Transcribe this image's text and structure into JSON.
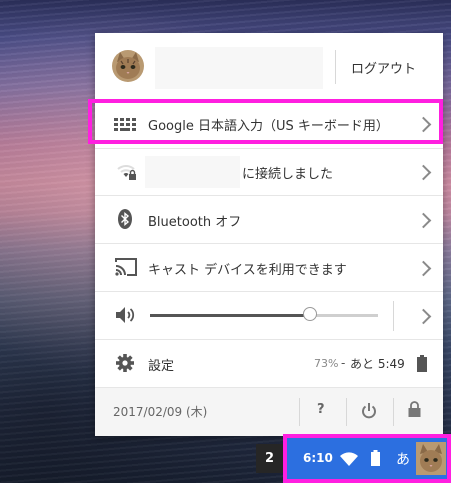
{
  "user": {
    "logout_label": "ログアウト"
  },
  "rows": {
    "ime_label": "Google 日本語入力（US キーボード用）",
    "network_suffix": "に接続しました",
    "bluetooth_label": "Bluetooth オフ",
    "cast_label": "キャスト デバイスを利用できます",
    "volume_level_percent": 70,
    "settings_label": "設定",
    "battery_percent": "73%",
    "battery_dash": "-",
    "battery_remaining": "あと 5:49"
  },
  "footer": {
    "date": "2017/02/09 (木)",
    "help_label": "?"
  },
  "shelf": {
    "window_count": "2",
    "time": "6:10",
    "ime_indicator": "あ"
  },
  "colors": {
    "highlight": "#ff1fe0",
    "tray_bg": "#2c6fe0"
  },
  "icons": {
    "avatar": "cat-avatar-icon",
    "keyboard": "keyboard-icon",
    "wifi_lock": "wifi-lock-icon",
    "bluetooth": "bluetooth-icon",
    "cast": "cast-icon",
    "volume": "volume-icon",
    "settings": "gear-icon",
    "battery": "battery-icon",
    "power": "power-icon",
    "lock": "lock-icon"
  }
}
